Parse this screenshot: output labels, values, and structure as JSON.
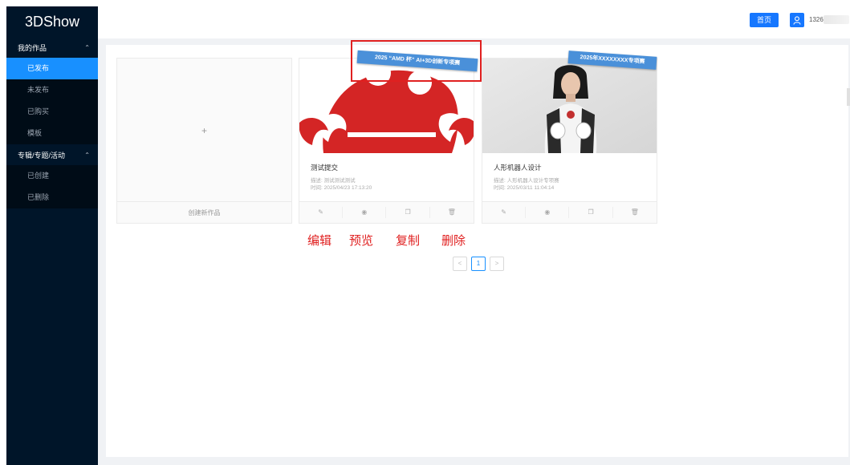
{
  "app": {
    "title": "3DShow"
  },
  "sidebar": {
    "groups": [
      {
        "label": "我的作品",
        "items": [
          "已发布",
          "未发布",
          "已购买",
          "模板"
        ]
      },
      {
        "label": "专辑/专题/活动",
        "items": [
          "已创建",
          "已删除"
        ]
      }
    ],
    "active_item": "已发布"
  },
  "header": {
    "home_label": "首页",
    "user_prefix": "1326"
  },
  "new_card": {
    "plus": "+",
    "label": "创建新作品"
  },
  "cards": [
    {
      "ribbon": "2025 “AMD 杯” AI+3D创新专项赛",
      "title": "测试提交",
      "desc": "描述: 测试测试测试",
      "time": "时间: 2025/04/23 17:13:20"
    },
    {
      "ribbon": "2025年XXXXXXXX专项赛",
      "title": "人形机器人设计",
      "desc": "描述: 人形机器人设计专项赛",
      "time": "时间: 2025/03/11 11:04:14"
    }
  ],
  "annotations": {
    "edit": "编辑",
    "preview": "预览",
    "copy": "复制",
    "delete": "删除"
  },
  "pagination": {
    "prev": "<",
    "current": "1",
    "next": ">"
  },
  "colors": {
    "sidebar": "#001529",
    "accent": "#1890ff",
    "highlight": "#e02020",
    "ribbon": "#4a90d9"
  }
}
